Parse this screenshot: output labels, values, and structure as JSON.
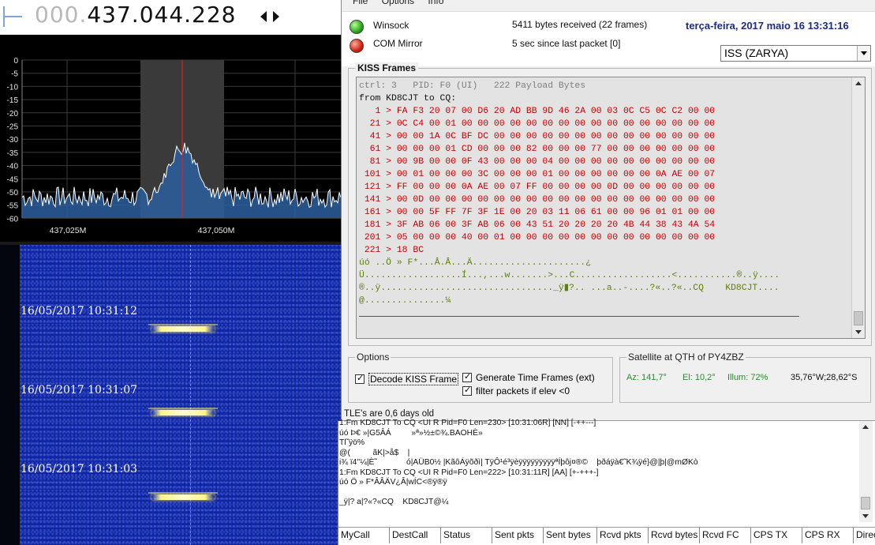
{
  "sdr": {
    "frequency_dim": "000.",
    "frequency_main": "437.044.228",
    "spectrum": {
      "y_ticks": [
        "0",
        "-5",
        "-10",
        "-15",
        "-20",
        "-25",
        "-30",
        "-35",
        "-40",
        "-45",
        "-50",
        "-55",
        "-60"
      ],
      "x_ticks": [
        "437,025M",
        "437,050M"
      ]
    },
    "waterfall_stamps": [
      "16/05/2017 10:31:12",
      "16/05/2017 10:31:07",
      "16/05/2017 10:31:03"
    ]
  },
  "telemetry": {
    "menu": [
      "File",
      "Options",
      "Info"
    ],
    "winsock_label": "Winsock",
    "com_label": "COM Mirror",
    "bytes_received": "5411 bytes received (22 frames)",
    "last_packet": "5 sec since last packet [0]",
    "clock": "terça-feira, 2017 maio 16  13:31:16",
    "satellite_selected": "ISS (ZARYA)",
    "kiss_title": "KISS Frames",
    "kiss_lines": [
      {
        "t": "head",
        "text": "ctrl: 3   PID: F0 (UI)   222 Payload Bytes"
      },
      {
        "t": "from",
        "text": "from KD8CJT to CQ:"
      },
      {
        "t": "hex",
        "text": "   1 > FA F3 20 07 00 D6 20 AD BB 9D 46 2A 00 03 0C C5 0C C2 00 00"
      },
      {
        "t": "hex",
        "text": "  21 > 0C C4 00 01 00 00 00 00 00 00 00 00 00 00 00 00 00 00 00 00"
      },
      {
        "t": "hex",
        "text": "  41 > 00 00 1A 0C BF DC 00 00 00 00 00 00 00 00 00 00 00 00 00 00"
      },
      {
        "t": "hex",
        "text": "  61 > 00 00 00 01 CD 00 00 00 82 00 00 00 77 00 00 00 00 00 00 00"
      },
      {
        "t": "hex",
        "text": "  81 > 00 9B 00 00 0F 43 00 00 00 04 00 00 00 00 00 00 00 00 00 00"
      },
      {
        "t": "hex",
        "text": " 101 > 00 01 00 00 00 3C 00 00 00 01 00 00 00 00 00 00 0A AE 00 07"
      },
      {
        "t": "hex",
        "text": " 121 > FF 00 00 00 0A AE 00 07 FF 00 00 00 00 0D 00 00 00 00 00 00"
      },
      {
        "t": "hex",
        "text": " 141 > 00 0D 00 00 00 00 00 00 00 00 00 00 00 00 00 00 00 00 00 00"
      },
      {
        "t": "hex",
        "text": " 161 > 00 00 5F FF 7F 3F 1E 00 20 03 11 06 61 00 00 96 01 01 00 00"
      },
      {
        "t": "hex",
        "text": " 181 > 3F AB 06 00 3F AB 06 00 43 51 20 20 20 20 4B 44 38 43 4A 54"
      },
      {
        "t": "hex",
        "text": " 201 > 05 00 00 00 40 00 01 00 00 00 00 00 00 00 00 00 00 00 00 00"
      },
      {
        "t": "hex",
        "text": " 221 > 18 BC"
      },
      {
        "t": "ascii",
        "text": "úó ..Ö » F*...Â.Â...Ä.....................¿"
      },
      {
        "t": "ascii",
        "text": "Ü..................Í...,...w.......>...C..................<...........®..ÿ...."
      },
      {
        "t": "ascii",
        "text": "®..ÿ................................_ÿ▮?.. ...a..-....?«..?«..CQ    KD8CJT...."
      },
      {
        "t": "ascii",
        "text": "@...............¼"
      }
    ],
    "options_title": "Options",
    "opt_decode": "Decode KISS Frame",
    "opt_timeframes": "Generate Time Frames (ext)",
    "opt_filter": "filter packets if elev <0",
    "qth_title": "Satellite at QTH of PY4ZBZ",
    "az": "Az: 141,7°",
    "el": "El: 10,2°",
    "illum": "Illum: 72%",
    "coords": "35,76°W;28,62°S",
    "tle_status": "TLE's are 0,6 days old"
  },
  "log": {
    "lines": [
      "1:Fm KD8CJT To CQ <UI R Pid=F0 Len=230> [10:31:06R] [NN] [-++---]",
      "úó Þ€ »|G5ÂÁ         »ª»½±©¾.BAOHÈ»",
      "Tl˜ÿö%",
      "@(          ãK|>å$    |",
      "i¾ ï4''¼|È˜             ó|AÜB0½ |KãôÁÿõðì| TÿÔ¹é³ÿèÿÿÿÿÿÿÿÿÿªÍþôj¤®©    þðáÿà€˜K¾ÿé}@|þ|@mØKò",
      "1:Fm KD8CJT To CQ <UI R Pid=F0 Len=222> [10:31:11R] [AA] [+-+++-]",
      "úó Ö » F*ÂÂÄV¿Â|wÍC<®ÿ®ÿ",
      "",
      "_ÿ|? a|?«?«CQ    KD8CJT@¼"
    ],
    "columns": [
      "MyCall",
      "DestCall",
      "Status",
      "Sent pkts",
      "Sent bytes",
      "Rcvd pkts",
      "Rcvd bytes",
      "Rcvd FC",
      "CPS TX",
      "CPS RX",
      "Direc"
    ]
  }
}
